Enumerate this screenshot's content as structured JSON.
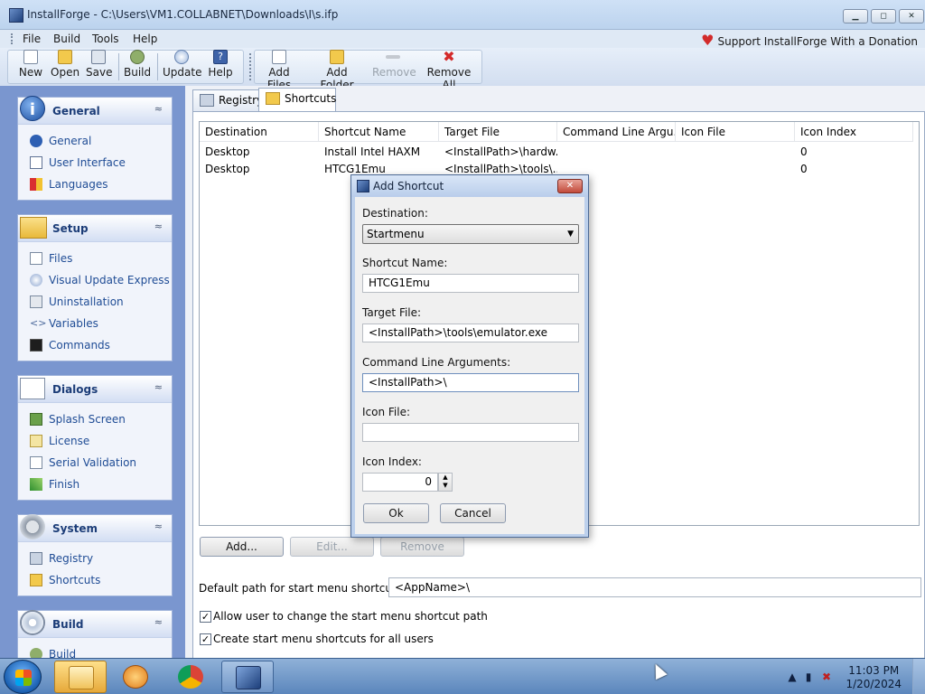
{
  "window": {
    "title": "InstallForge - C:\\Users\\VM1.COLLABNET\\Downloads\\I\\s.ifp",
    "controls": [
      "▁",
      "◻",
      "✕"
    ]
  },
  "menubar": {
    "items": [
      "File",
      "Build",
      "Tools",
      "Help"
    ],
    "donation": "Support InstallForge With a Donation"
  },
  "toolbar": {
    "buttons": [
      {
        "label": "New",
        "icon": "new-file-icon"
      },
      {
        "label": "Open",
        "icon": "open-folder-icon"
      },
      {
        "label": "Save",
        "icon": "save-icon"
      },
      {
        "label": "Build",
        "icon": "build-gear-icon"
      },
      {
        "label": "Update",
        "icon": "update-icon"
      },
      {
        "label": "Help",
        "icon": "help-icon"
      }
    ],
    "file_buttons": [
      {
        "label": "Add Files",
        "icon": "add-files-icon",
        "enabled": true
      },
      {
        "label": "Add Folder",
        "icon": "add-folder-icon",
        "enabled": true
      },
      {
        "label": "Remove",
        "icon": "remove-icon",
        "enabled": false
      },
      {
        "label": "Remove All",
        "icon": "remove-all-icon",
        "enabled": true
      }
    ]
  },
  "sidebar": {
    "sections": [
      {
        "title": "General",
        "items": [
          "General",
          "User Interface",
          "Languages"
        ]
      },
      {
        "title": "Setup",
        "items": [
          "Files",
          "Visual Update Express",
          "Uninstallation",
          "Variables",
          "Commands"
        ]
      },
      {
        "title": "Dialogs",
        "items": [
          "Splash Screen",
          "License",
          "Serial Validation",
          "Finish"
        ]
      },
      {
        "title": "System",
        "items": [
          "Registry",
          "Shortcuts"
        ]
      },
      {
        "title": "Build",
        "items": [
          "Build"
        ]
      }
    ],
    "collapse_glyph": "≈"
  },
  "tabs": [
    "Registry",
    "Shortcuts"
  ],
  "shortcuts_table": {
    "columns": [
      "Destination",
      "Shortcut Name",
      "Target File",
      "Command Line Argu...",
      "Icon File",
      "Icon Index"
    ],
    "rows": [
      [
        "Desktop",
        "Install Intel HAXM",
        "<InstallPath>\\hardw...",
        "",
        "",
        "0"
      ],
      [
        "Desktop",
        "HTCG1Emu",
        "<InstallPath>\\tools\\...",
        "",
        "",
        "0"
      ]
    ]
  },
  "list_buttons": {
    "add": "Add...",
    "edit": "Edit...",
    "remove": "Remove"
  },
  "start_menu": {
    "default_path_label": "Default path for start menu shortcuts:",
    "default_path_value": "<AppName>\\",
    "options": [
      {
        "label": "Allow user to change the start menu shortcut path",
        "checked": true
      },
      {
        "label": "Create start menu shortcuts for all users",
        "checked": true
      }
    ]
  },
  "dialog": {
    "title": "Add Shortcut",
    "destination_label": "Destination:",
    "destination_value": "Startmenu",
    "shortcut_name_label": "Shortcut Name:",
    "shortcut_name_value": "HTCG1Emu",
    "target_file_label": "Target File:",
    "target_file_value": "<InstallPath>\\tools\\emulator.exe",
    "cmd_args_label": "Command Line Arguments:",
    "cmd_args_value": "<InstallPath>\\",
    "icon_file_label": "Icon File:",
    "icon_file_value": "",
    "icon_index_label": "Icon Index:",
    "icon_index_value": "0",
    "ok": "Ok",
    "cancel": "Cancel"
  },
  "taskbar": {
    "time": "11:03 PM",
    "date": "1/20/2024",
    "apps": [
      "file-explorer-icon",
      "media-player-icon",
      "chrome-icon",
      "installforge-icon"
    ]
  }
}
